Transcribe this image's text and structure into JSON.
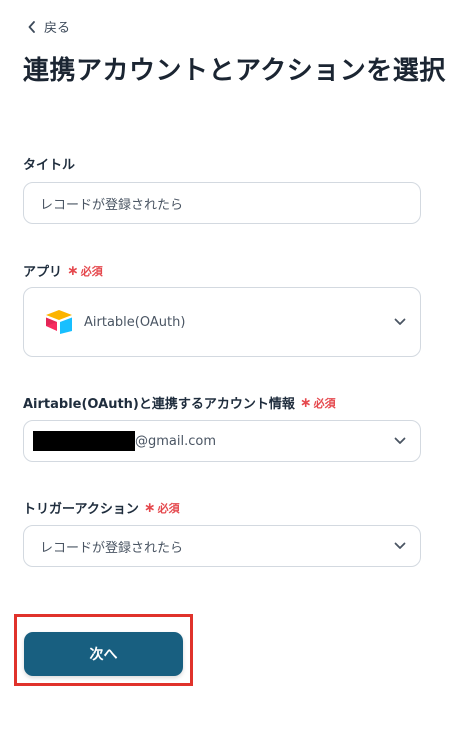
{
  "nav": {
    "back_label": "戻る"
  },
  "page_title": "連携アカウントとアクションを選択",
  "fields": {
    "title": {
      "label": "タイトル",
      "value": "レコードが登録されたら"
    },
    "app": {
      "label": "アプリ",
      "required_label": "必須",
      "selected": "Airtable(OAuth)",
      "icon": "airtable-logo-icon"
    },
    "account": {
      "label": "Airtable(OAuth)と連携するアカウント情報",
      "required_label": "必須",
      "email_suffix": "@gmail.com"
    },
    "trigger": {
      "label": "トリガーアクション",
      "required_label": "必須",
      "selected": "レコードが登録されたら"
    }
  },
  "next_button": {
    "label": "次へ"
  },
  "colors": {
    "primary_button": "#185f80",
    "required": "#e5484d",
    "highlight_border": "#e0322b"
  }
}
